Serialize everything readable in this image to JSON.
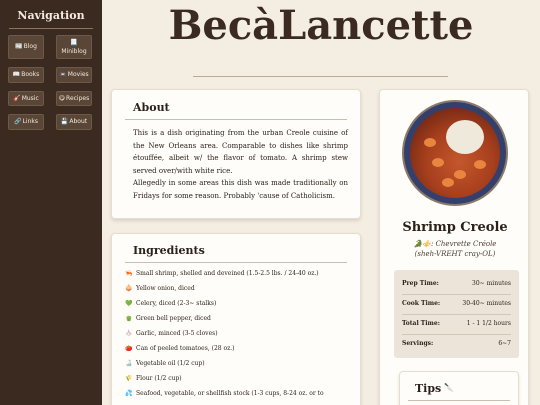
{
  "sidebar": {
    "title": "Navigation",
    "items": [
      {
        "icon": "📰",
        "label": "Blog"
      },
      {
        "icon": "📃",
        "label": "Miniblog"
      },
      {
        "icon": "📖",
        "label": "Books"
      },
      {
        "icon": "📼",
        "label": "Movies"
      },
      {
        "icon": "🎸",
        "label": "Music"
      },
      {
        "icon": "😋",
        "label": "Recipes"
      },
      {
        "icon": "🔗",
        "label": "Links"
      },
      {
        "icon": "💾",
        "label": "About"
      }
    ]
  },
  "header": {
    "logo": "BecàLancette"
  },
  "about": {
    "title": "About",
    "paragraphs": [
      "This is a dish originating from the urban Creole cuisine of the New Orleans area. Comparable to dishes like shrimp étouffée, albeit w/ the flavor of tomato. A shrimp stew served over/with white rice.",
      "Allegedly in some areas this dish was made traditionally on Fridays for some reason. Probably 'cause of Catholicism."
    ]
  },
  "ingredients": {
    "title": "Ingredients",
    "items": [
      {
        "icon": "🦐",
        "text": "Small shrimp, shelled and deveined (1.5-2.5 lbs. / 24-40 oz.)"
      },
      {
        "icon": "🧅",
        "text": "Yellow onion, diced"
      },
      {
        "icon": "💚",
        "text": "Celery, diced (2-3~ stalks)"
      },
      {
        "icon": "🫑",
        "text": "Green bell pepper, diced"
      },
      {
        "icon": "🧄",
        "text": "Garlic, minced (3-5 cloves)"
      },
      {
        "icon": "🍅",
        "text": "Can of peeled tomatoes, (28 oz.)"
      },
      {
        "icon": "🍶",
        "text": "Vegetable oil (1/2 cup)"
      },
      {
        "icon": "🌾",
        "text": "Flour (1/2 cup)"
      },
      {
        "icon": "💦",
        "text": "Seafood, vegetable, or shellfish stock (1-3 cups, 8-24 oz. or to"
      }
    ]
  },
  "recipe": {
    "name": "Shrimp Creole",
    "flags": "🐊⚜️",
    "native_name": "Chevrette Créole",
    "pronunciation": "(sheh-VREHT cray-OL)",
    "stats": [
      {
        "label": "Prep Time:",
        "value": "30~ minutes"
      },
      {
        "label": "Cook Time:",
        "value": "30-40~ minutes"
      },
      {
        "label": "Total Time:",
        "value": "1 - 1 1/2 hours"
      },
      {
        "label": "Servings:",
        "value": "6~7"
      }
    ]
  },
  "tips": {
    "title": "Tips",
    "icon": "🔪"
  }
}
